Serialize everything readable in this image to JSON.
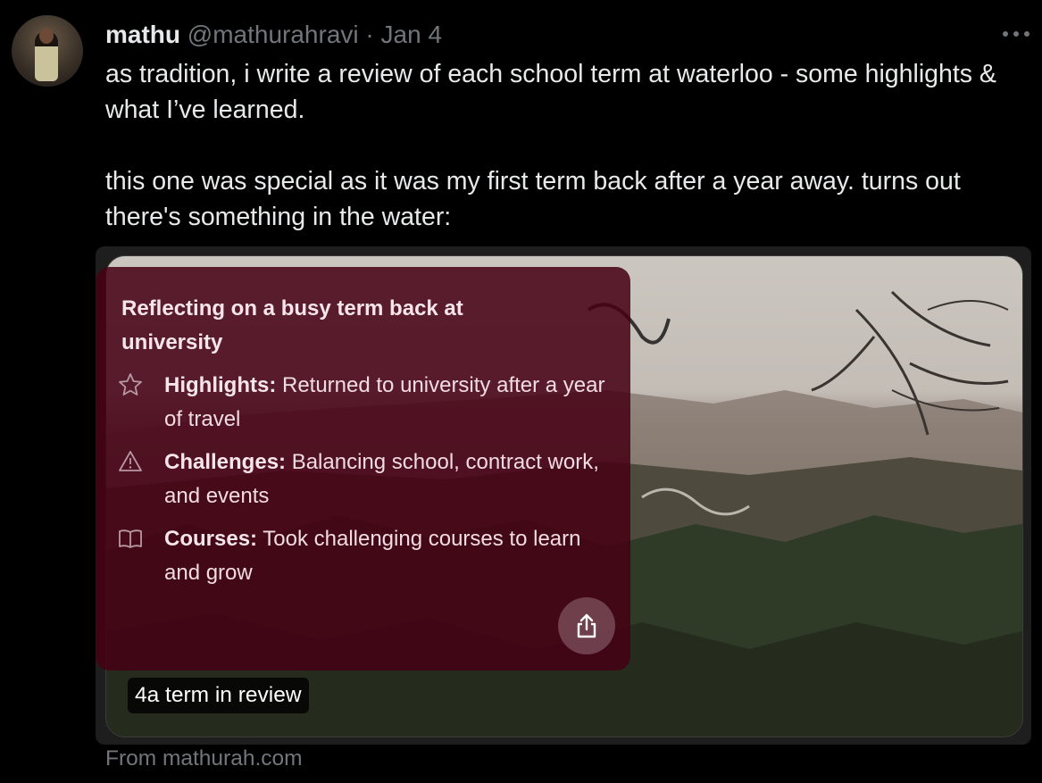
{
  "tweet": {
    "author_name": "mathu",
    "handle": "@mathurahravi",
    "separator": "·",
    "date": "Jan 4",
    "more_icon": "more-horizontal-icon",
    "text_para_1": "as tradition, i write a review of each school term at waterloo - some highlights & what I’ve learned.",
    "text_para_2": "this one was special as it was my first term back after a year away. turns out there's something in the water:"
  },
  "card": {
    "caption": "4a term in review",
    "source": "From mathurah.com"
  },
  "summary_panel": {
    "title": "Reflecting on a busy term back at university",
    "items": [
      {
        "icon": "star-icon",
        "label": "Highlights:",
        "text": " Returned to university after a year of travel"
      },
      {
        "icon": "warning-icon",
        "label": "Challenges:",
        "text": " Balancing school, contract work, and events"
      },
      {
        "icon": "book-icon",
        "label": "Courses:",
        "text": " Took challenging courses to learn and grow"
      }
    ],
    "share_icon": "share-icon",
    "background_color": "#46001499"
  }
}
